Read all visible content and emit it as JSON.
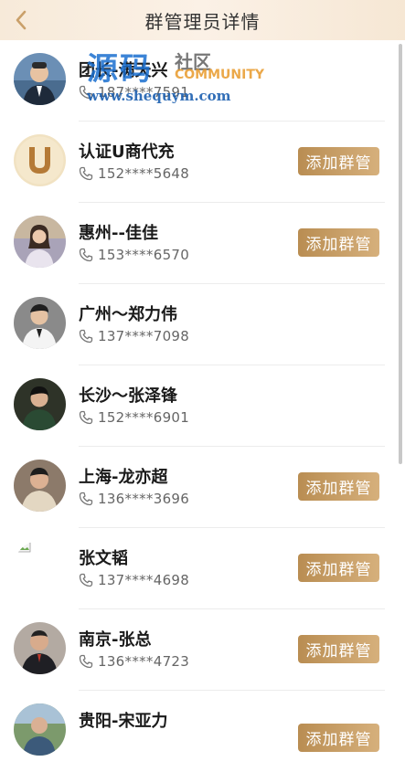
{
  "header": {
    "title": "群管理员详情",
    "back_icon": "chevron-left-icon"
  },
  "colors": {
    "accent_start": "#b98d52",
    "accent_end": "#d6b07c",
    "back": "#caa06a"
  },
  "watermark": {
    "big": "源码",
    "cn": "社区",
    "en": "COMMUNITY",
    "url": "www.shequym.com"
  },
  "members": [
    {
      "name": "团长-满天兴",
      "phone": "187****7591",
      "button": ""
    },
    {
      "name": "认证U商代充",
      "phone": "152****5648",
      "button": "添加群管"
    },
    {
      "name": "惠州--佳佳",
      "phone": "153****6570",
      "button": "添加群管"
    },
    {
      "name": "广州～郑力伟",
      "phone": "137****7098",
      "button": ""
    },
    {
      "name": "长沙～张泽锋",
      "phone": "152****6901",
      "button": ""
    },
    {
      "name": "上海-龙亦超",
      "phone": "136****3696",
      "button": "添加群管"
    },
    {
      "name": "张文韬",
      "phone": "137****4698",
      "button": "添加群管"
    },
    {
      "name": "南京-张总",
      "phone": "136****4723",
      "button": "添加群管"
    },
    {
      "name": "贵阳-宋亚力",
      "phone": "",
      "button": "添加群管"
    }
  ]
}
